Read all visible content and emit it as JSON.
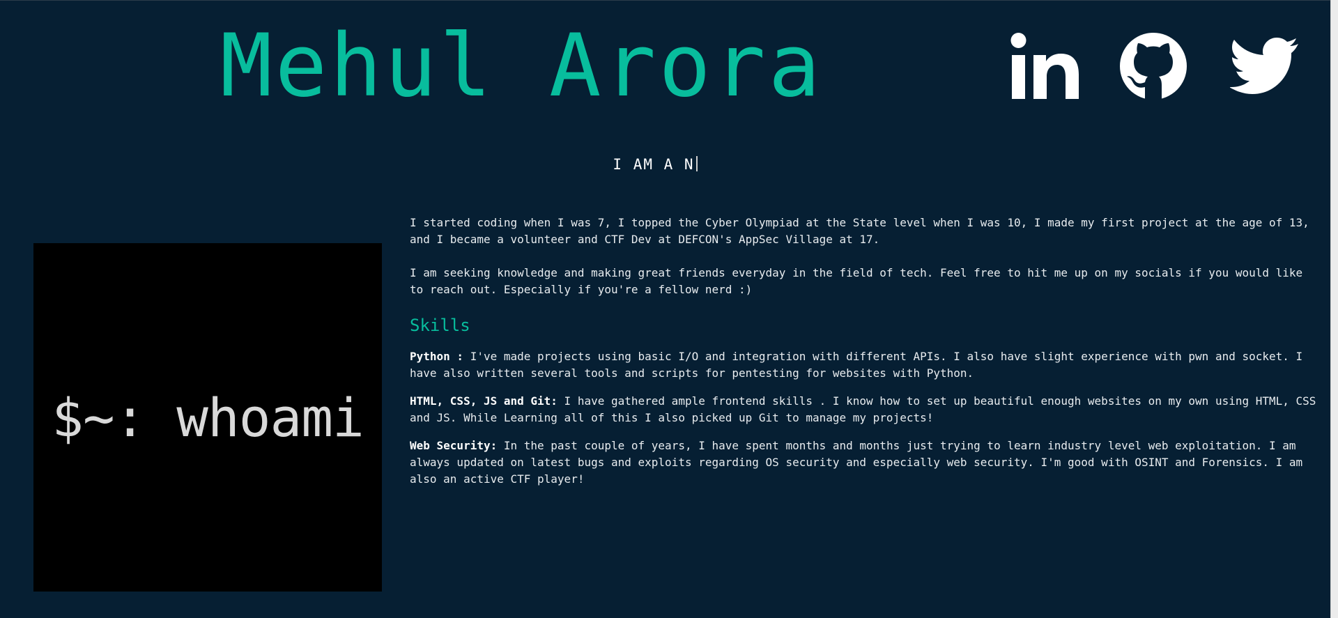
{
  "header": {
    "name": "Mehul Arora"
  },
  "socials": [
    {
      "name": "linkedin-icon",
      "label": "LinkedIn"
    },
    {
      "name": "github-icon",
      "label": "GitHub"
    },
    {
      "name": "twitter-icon",
      "label": "Twitter"
    }
  ],
  "typing": {
    "text": "I AM A N"
  },
  "avatar": {
    "text": "$~: whoami"
  },
  "about": {
    "paragraph1": "I started coding when I was 7, I topped the Cyber Olympiad at the State level when I was 10, I made my first project at the age of 13, and I became a volunteer and CTF Dev at DEFCON's AppSec Village at 17.",
    "paragraph2": "I am seeking knowledge and making great friends everyday in the field of tech. Feel free to hit me up on my socials if you would like to reach out. Especially if you're a fellow nerd :)"
  },
  "skills": {
    "heading": "Skills",
    "items": [
      {
        "name": "Python :",
        "description": " I've made projects using basic I/O and integration with different APIs. I also have slight experience with pwn and socket. I have also written several tools and scripts for pentesting for websites with Python."
      },
      {
        "name": "HTML, CSS, JS and Git:",
        "description": " I have gathered ample frontend skills . I know how to set up beautiful enough websites on my own using HTML, CSS and JS. While Learning all of this I also picked up Git to manage my projects!"
      },
      {
        "name": "Web Security:",
        "description": " In the past couple of years, I have spent months and months just trying to learn industry level web exploitation. I am always updated on latest bugs and exploits regarding OS security and especially web security. I'm good with OSINT and Forensics. I am also an active CTF player!"
      }
    ]
  },
  "colors": {
    "background": "#061f33",
    "accent": "#08bd9d",
    "text": "#e8ecef",
    "avatar_bg": "#000000"
  }
}
